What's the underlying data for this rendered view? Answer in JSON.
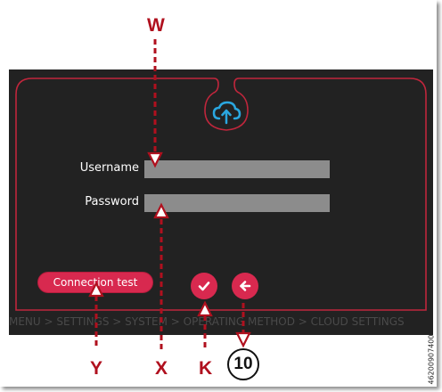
{
  "login_form": {
    "username_label": "Username",
    "username_value": "",
    "password_label": "Password",
    "password_value": ""
  },
  "buttons": {
    "connection_test_label": "Connection test",
    "confirm_icon": "checkmark-icon",
    "back_icon": "arrow-left-icon"
  },
  "header_icon": "cloud-upload-icon",
  "breadcrumb": "MENU > SETTINGS > SYSTEM > OPERATING METHOD > CLOUD SETTINGS",
  "callouts": {
    "w": "W",
    "x": "X",
    "y": "Y",
    "k": "K",
    "ten": "10"
  },
  "document_number": "46200907400",
  "colors": {
    "screen_background": "#222222",
    "accent_red": "#d8294f",
    "frame_line": "#c0263c",
    "icon_blue": "#2aa7e0",
    "callout_red": "#b0101e",
    "input_gray": "#8c8c8c"
  }
}
